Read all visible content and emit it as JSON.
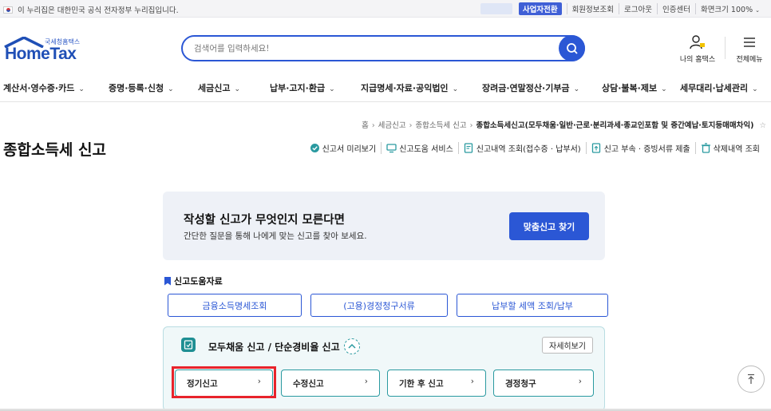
{
  "topbar": {
    "notice": "이 누리집은 대한민국 공식 전자정부 누리집입니다.",
    "business_switch": "사업자전환",
    "links": [
      "회원정보조회",
      "로그아웃",
      "인증센터",
      "화면크기 100%"
    ]
  },
  "logo": {
    "small": "국세청홈택스",
    "main": "HomeTax"
  },
  "search": {
    "placeholder": "검색어를 입력하세요!"
  },
  "header": {
    "my_hometax": "나의 홈택스",
    "all_menu": "전체메뉴"
  },
  "gnb": [
    "계산서·영수증·카드",
    "증명·등록·신청",
    "세금신고",
    "납부·고지·환급",
    "지급명세·자료·공익법인",
    "장려금·연말정산·기부금",
    "상담·불복·제보",
    "세무대리·납세관리"
  ],
  "breadcrumb": {
    "home": "홈",
    "level1": "세금신고",
    "level2": "종합소득세 신고",
    "current": "종합소득세신고(모두채움·일반·근로·분리과세·종교인포함 및 중간예납·토지등매매차익)"
  },
  "page_title": "종합소득세 신고",
  "actions": [
    "신고서 미리보기",
    "신고도움 서비스",
    "신고내역 조회(접수증 · 납부서)",
    "신고 부속 · 증빙서류 제출",
    "삭제내역 조회"
  ],
  "guide": {
    "title": "작성할 신고가 무엇인지 모른다면",
    "subtitle": "간단한 질문을 통해 나에게 맞는 신고를 찾아 보세요.",
    "button": "맞춤신고 찾기"
  },
  "help": {
    "title": "신고도움자료",
    "buttons": [
      "금융소득명세조회",
      "(고용)경정청구서류",
      "납부할 세액 조회/납부"
    ]
  },
  "panel": {
    "title": "모두채움 신고 / 단순경비율 신고",
    "detail": "자세히보기",
    "types": [
      "정기신고",
      "수정신고",
      "기한 후 신고",
      "경정청구"
    ]
  },
  "colors": {
    "primary": "#2b57d5",
    "teal": "#2a9aa0",
    "highlight": "#e8232b"
  },
  "icons": [
    "search-icon",
    "person-bell-icon",
    "hamburger-icon",
    "star-icon",
    "scroll-top-icon"
  ]
}
